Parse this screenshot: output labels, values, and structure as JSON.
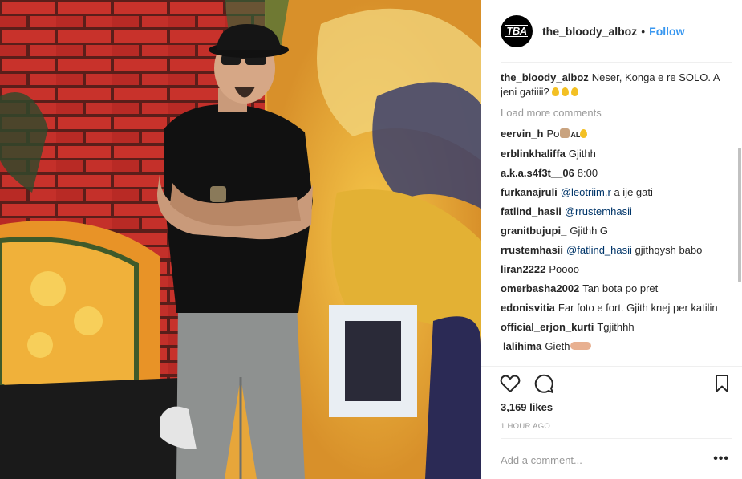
{
  "post": {
    "avatar_text": "TBA",
    "username": "the_bloody_alboz",
    "separator": "•",
    "follow_label": "Follow",
    "caption": {
      "user": "the_bloody_alboz",
      "text": "Neser, Konga e re SOLO. A jeni gatiiii?"
    },
    "load_more_label": "Load more comments",
    "comments": [
      {
        "user": "eervin_h",
        "text": "Po",
        "suffix": "AL"
      },
      {
        "user": "erblinkhaliffa",
        "text": "Gjithh"
      },
      {
        "user": "a.k.a.s4f3t__06",
        "text": "8:00"
      },
      {
        "user": "furkanajruli",
        "mention": "@leotriim.r",
        "text": " a ije gati"
      },
      {
        "user": "fatlind_hasii",
        "mention": "@rrustemhasii",
        "text": ""
      },
      {
        "user": "granitbujupi_",
        "text": "Gjithh G"
      },
      {
        "user": "rrustemhasii",
        "mention": "@fatlind_hasii",
        "text": " gjithqysh babo"
      },
      {
        "user": "liran2222",
        "text": "Poooo"
      },
      {
        "user": "omerbasha2002",
        "text": "Tan bota po pret"
      },
      {
        "user": "edonisvitia",
        "text": "Far foto e fort. Gjith knej per katilin"
      },
      {
        "user": "official_erjon_kurti",
        "text": "Tgjithhh"
      },
      {
        "user": "lalihima",
        "text": "Gieth"
      }
    ],
    "likes": "3,169 likes",
    "timestamp": "1 HOUR AGO",
    "add_comment_placeholder": "Add a comment...",
    "more_label": "•••"
  },
  "icons": {
    "like": "heart-icon",
    "comment": "comment-icon",
    "save": "bookmark-icon",
    "more": "more-options-icon"
  },
  "colors": {
    "link": "#3897f0",
    "mention": "#003569",
    "muted": "#999999",
    "text": "#262626"
  }
}
